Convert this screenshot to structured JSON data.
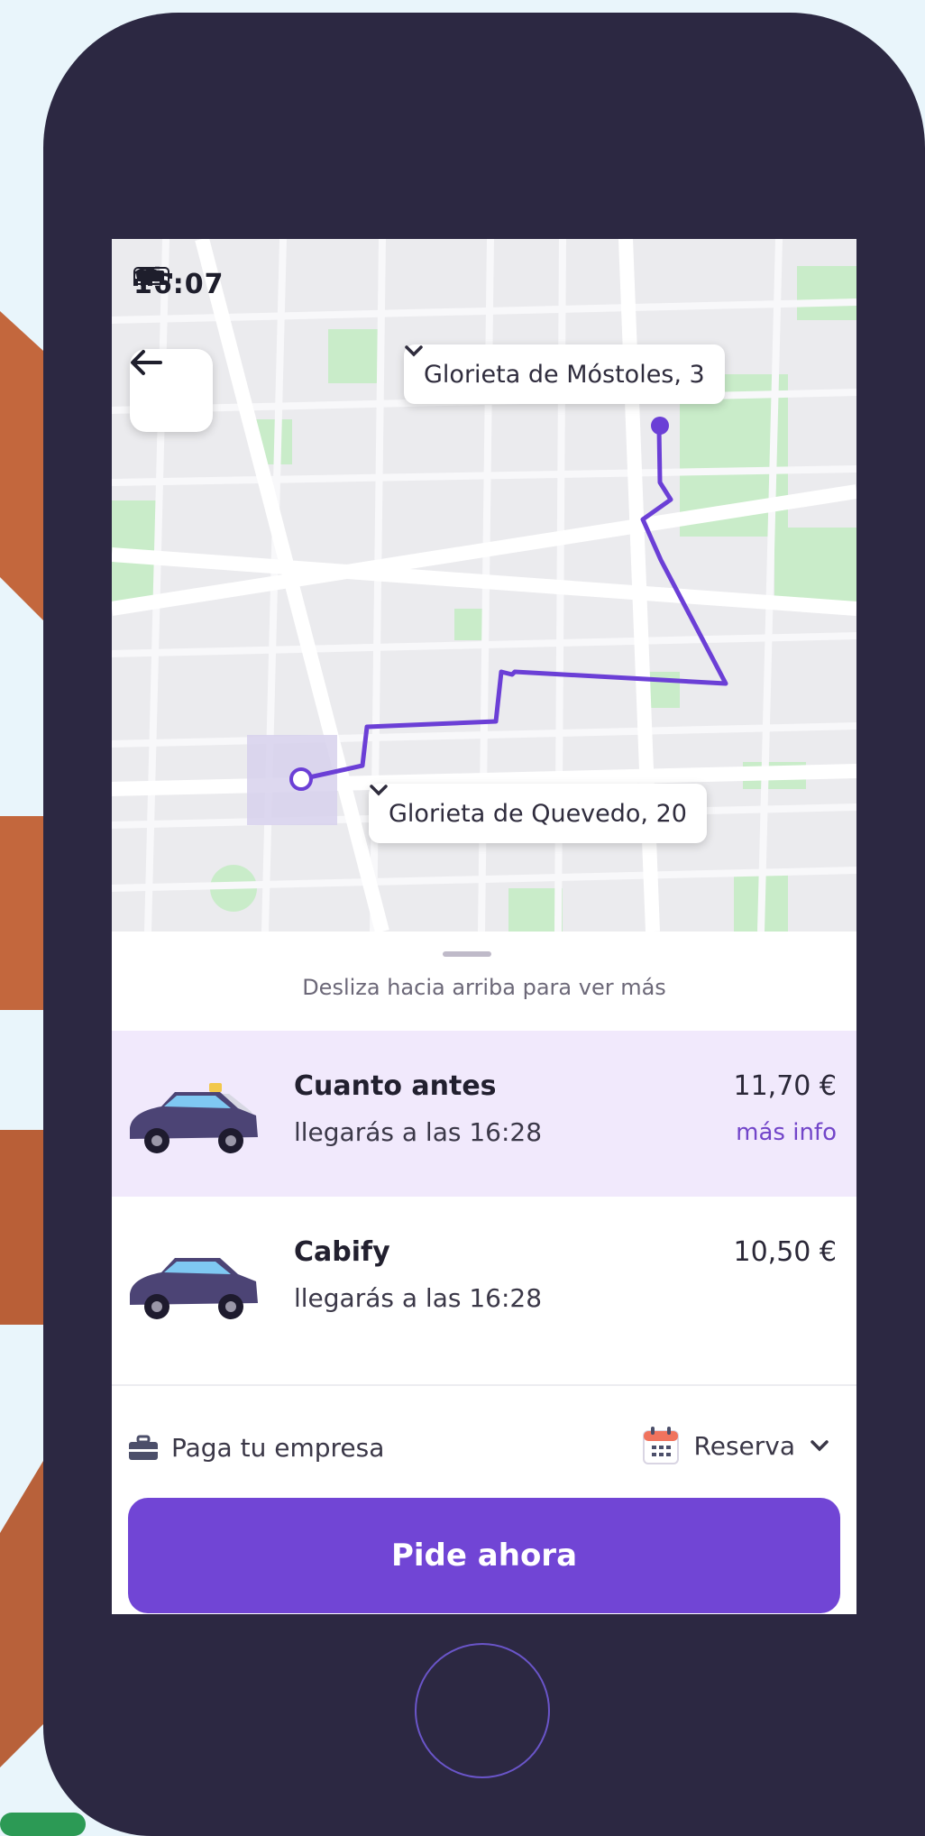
{
  "status_bar": {
    "time": "16:07"
  },
  "map": {
    "destination_label": "Glorieta de Móstoles, 3",
    "origin_label": "Glorieta de Quevedo, 20"
  },
  "sheet": {
    "hint": "Desliza hacia arriba para ver más",
    "options": [
      {
        "title": "Cuanto antes",
        "eta": "llegarás a las 16:28",
        "price": "11,70 €",
        "info_link": "más info",
        "selected": true
      },
      {
        "title": "Cabify",
        "eta": "llegarás a las 16:28",
        "price": "10,50 €",
        "selected": false
      }
    ],
    "payment_label": "Paga tu empresa",
    "reserve_label": "Reserva",
    "cta_label": "Pide ahora"
  },
  "colors": {
    "accent": "#7145d5",
    "phone_body": "#2c2842",
    "selected_bg": "#f1e9fc",
    "route_line": "#6b3fd6",
    "background": "#e9f5fb",
    "decor_orange": "#c3673d"
  },
  "icons": [
    "location-arrow-icon",
    "signal-icon",
    "wifi-icon",
    "battery-icon",
    "back-arrow-icon",
    "chevron-down-icon",
    "taxi-car-icon",
    "car-icon",
    "briefcase-icon",
    "calendar-icon"
  ]
}
